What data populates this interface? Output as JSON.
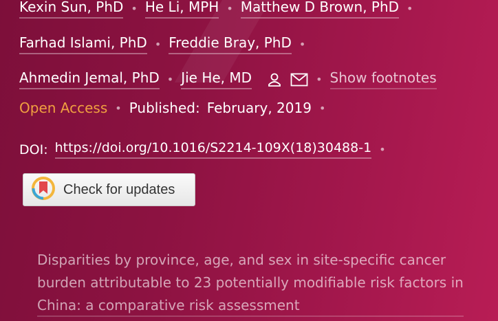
{
  "authors": {
    "row1": [
      "Kexin Sun, PhD",
      "He Li, MPH",
      "Matthew D Brown, PhD"
    ],
    "row2": [
      "Farhad Islami, PhD",
      "Freddie Bray, PhD"
    ],
    "row3": [
      "Ahmedin Jemal, PhD",
      "Jie He, MD"
    ]
  },
  "show_footnotes": "Show footnotes",
  "access": {
    "open_access": "Open Access",
    "published_label": "Published:",
    "published_date": "February, 2019"
  },
  "doi": {
    "label": "DOI:",
    "url": "https://doi.org/10.1016/S2214-109X(18)30488-1"
  },
  "check_updates": "Check for updates",
  "related_title": "Disparities by province, age, and sex in site-specific cancer burden attributable to 23 potentially modifiable risk factors in China: a comparative risk assessment",
  "colors": {
    "background": "#8c1241",
    "open_access": "#f0a040",
    "button": "#f0f0f0"
  },
  "icons": [
    "person-icon",
    "mail-icon",
    "crossmark-icon"
  ]
}
